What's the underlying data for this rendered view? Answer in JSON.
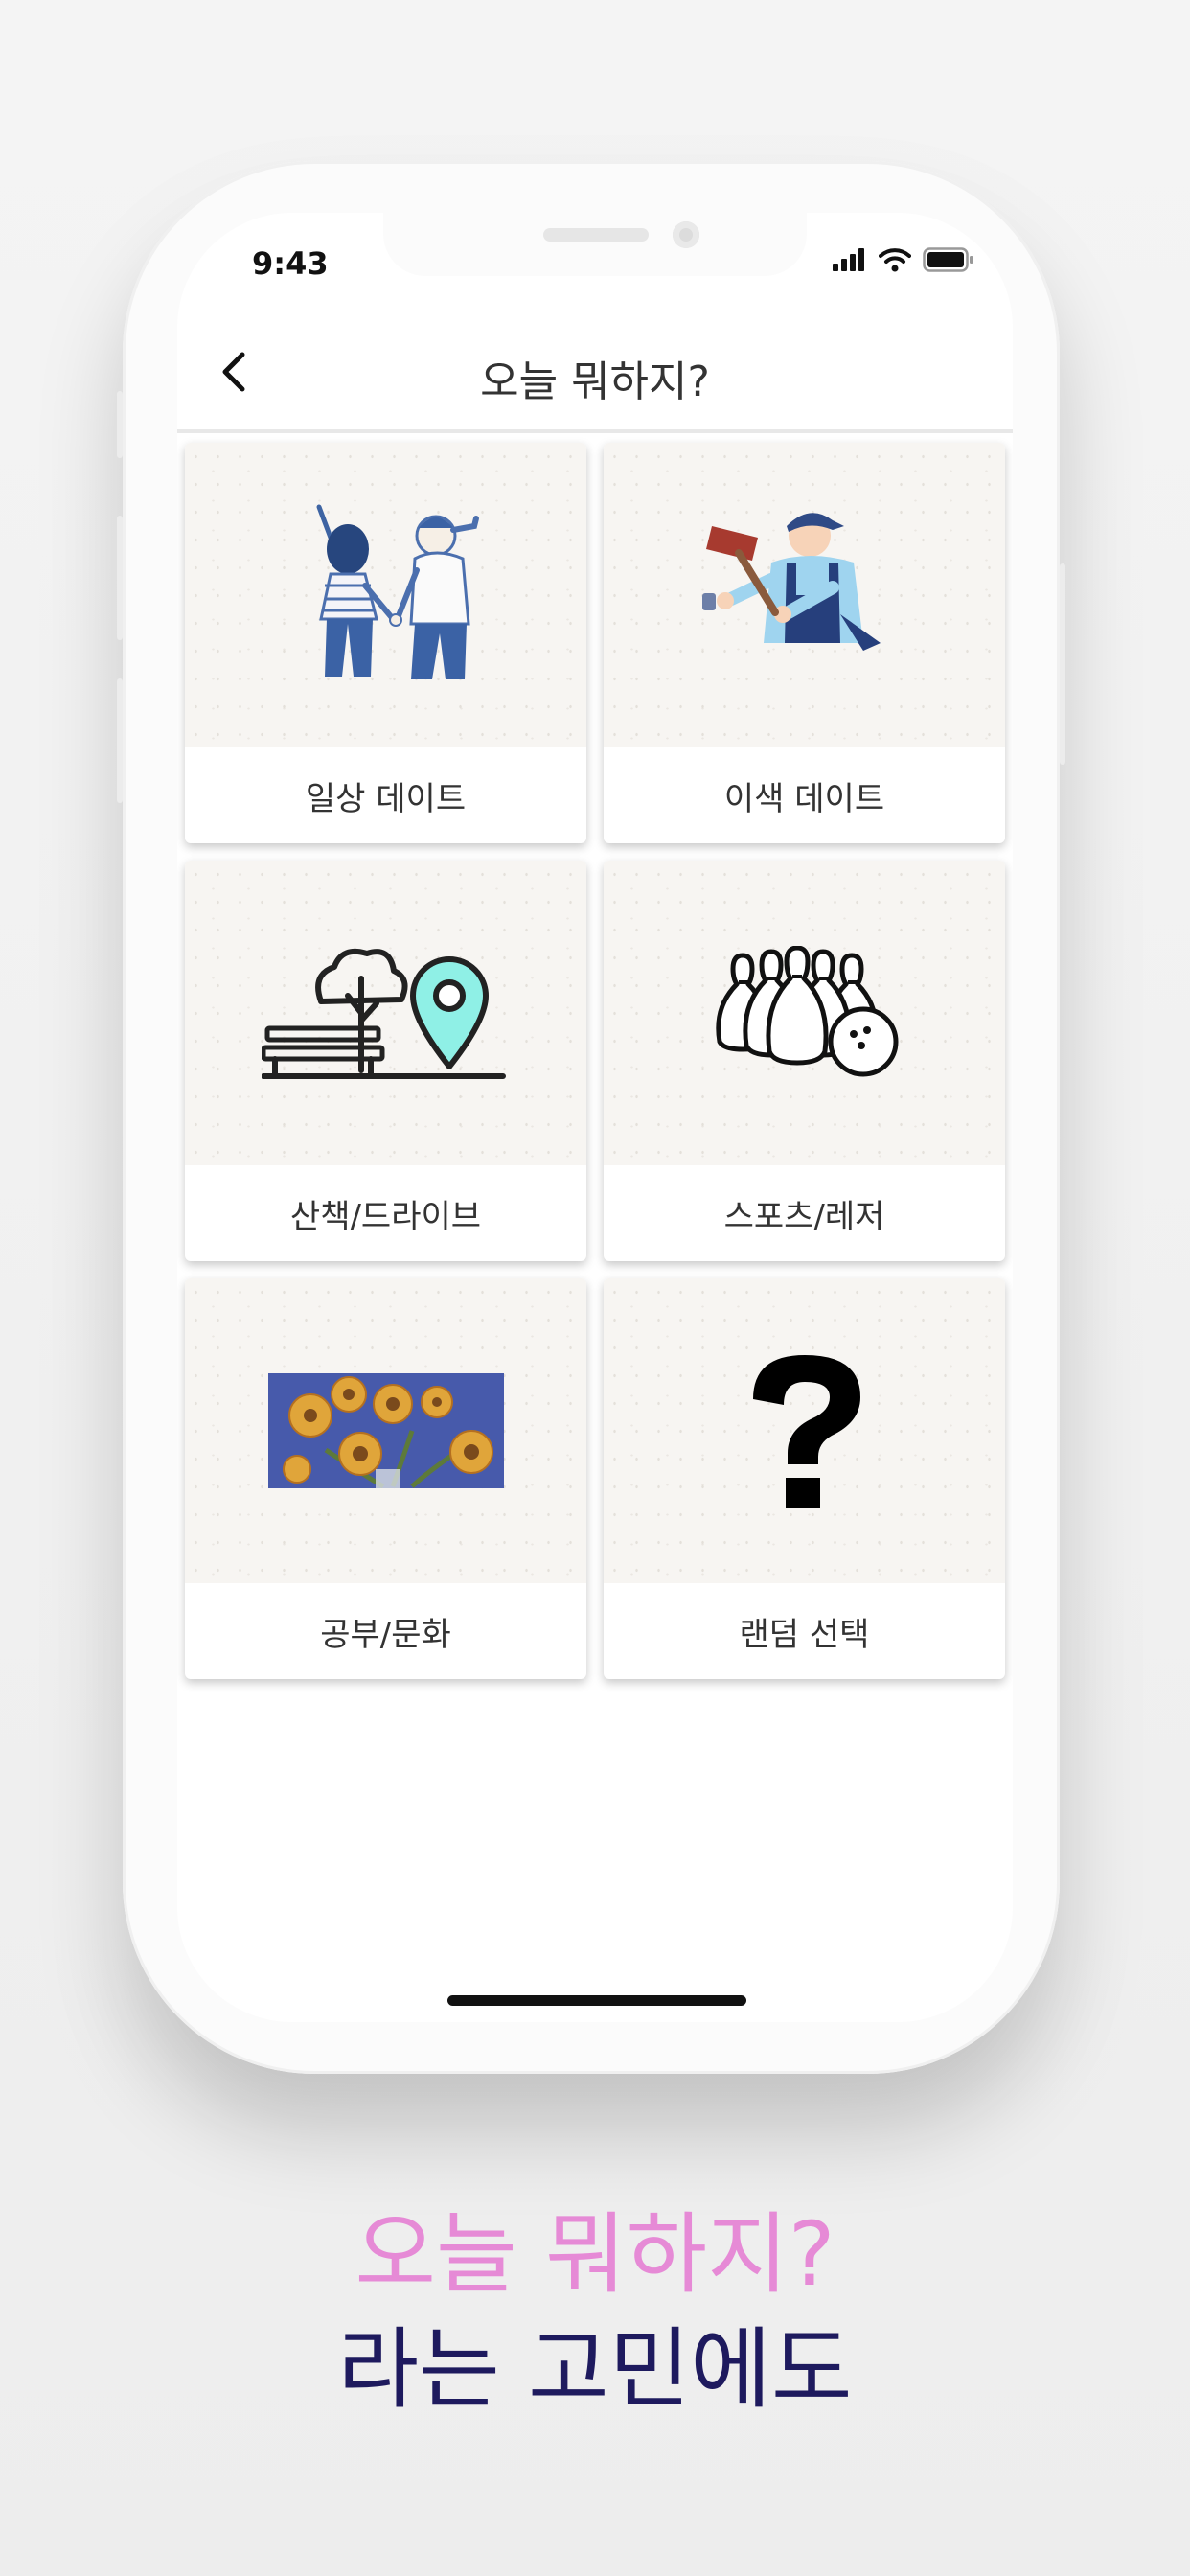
{
  "status_bar": {
    "time": "9:43",
    "signal_icon": "signal-bars-icon",
    "wifi_icon": "wifi-icon",
    "battery_icon": "battery-icon"
  },
  "nav": {
    "title": "오늘 뭐하지?",
    "back_icon": "chevron-left-icon"
  },
  "categories": [
    {
      "label": "일상 데이트",
      "icon": "couple-holding-hands-icon"
    },
    {
      "label": "이색 데이트",
      "icon": "craftsman-hammer-icon"
    },
    {
      "label": "산책/드라이브",
      "icon": "park-bench-location-pin-icon",
      "accent": "#8ff0e6"
    },
    {
      "label": "스포츠/레저",
      "icon": "bowling-pins-icon"
    },
    {
      "label": "공부/문화",
      "icon": "sunflower-painting-icon"
    },
    {
      "label": "랜덤 선택",
      "icon": "question-mark-icon"
    }
  ],
  "caption": {
    "line1": "오늘 뭐하지?",
    "line2": "라는 고민에도",
    "line1_color": "#e68ad6",
    "line2_color": "#1e1a5e"
  }
}
